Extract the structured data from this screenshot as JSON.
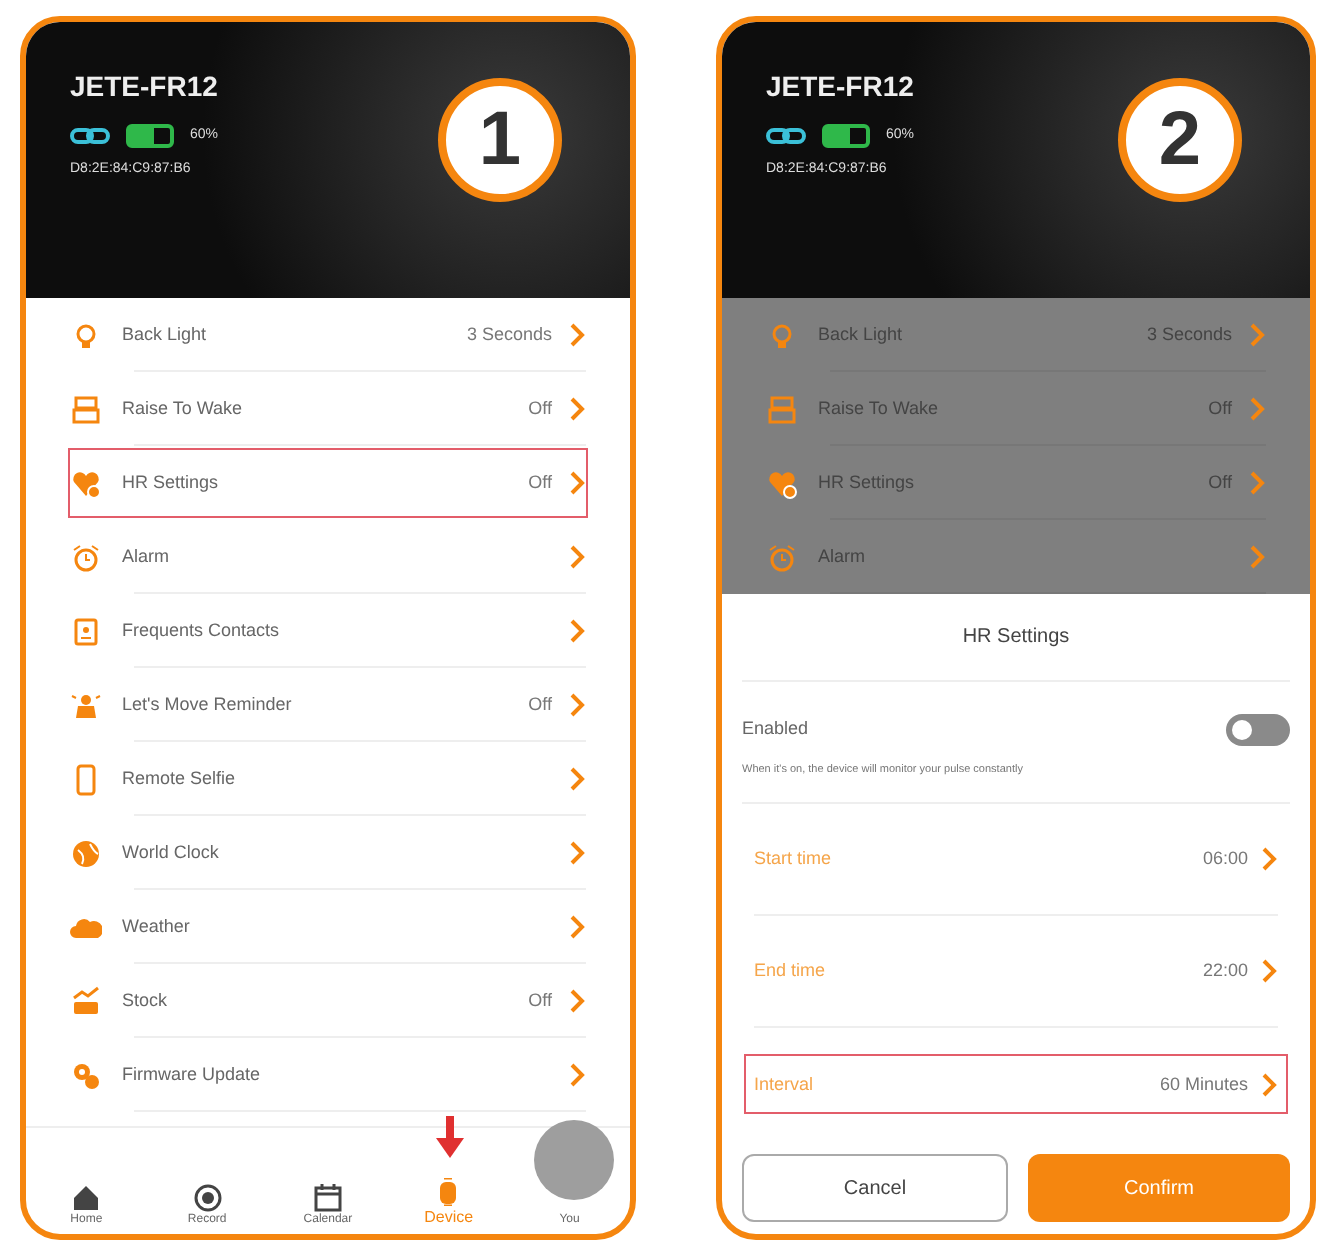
{
  "screens": [
    {
      "step": "1",
      "device": {
        "name": "JETE-FR12",
        "battery": {
          "level": 0.6,
          "text": "60%"
        },
        "address": "D8:2E:84:C9:87:B6"
      },
      "settings": [
        {
          "label": "Back Light",
          "value": "3 Seconds",
          "highlighted": false
        },
        {
          "label": "Raise To Wake",
          "value": "Off",
          "highlighted": false
        },
        {
          "label": "HR Settings",
          "value": "Off",
          "highlighted": true
        },
        {
          "label": "Alarm",
          "highlighted": false
        },
        {
          "label": "Frequents Contacts",
          "highlighted": false
        },
        {
          "label": "Let's Move Reminder",
          "value": "Off",
          "highlighted": false
        },
        {
          "label": "Remote Selfie",
          "highlighted": false
        },
        {
          "label": "World Clock",
          "highlighted": false
        },
        {
          "label": "Weather",
          "highlighted": false
        },
        {
          "label": "Stock",
          "value": "Off",
          "highlighted": false
        },
        {
          "label": "Firmware Update",
          "highlighted": false
        }
      ],
      "tab_bar": [
        {
          "label": "Home",
          "selected": false
        },
        {
          "label": "Record",
          "selected": false
        },
        {
          "label": "Calendar",
          "selected": false
        },
        {
          "label": "Device",
          "selected": true,
          "pointed": true
        },
        {
          "label": "You",
          "selected": false,
          "avatar": true
        }
      ]
    },
    {
      "step": "2",
      "device": {
        "name": "JETE-FR12",
        "battery": {
          "level": 0.6,
          "text": "60%"
        },
        "address": "D8:2E:84:C9:87:B6"
      },
      "settings": [
        {
          "label": "Back Light",
          "value": "3 Seconds",
          "highlighted": false
        },
        {
          "label": "Raise To Wake",
          "value": "Off",
          "highlighted": false
        },
        {
          "label": "HR Settings",
          "value": "Off",
          "highlighted": false
        },
        {
          "label": "Alarm",
          "highlighted": false
        }
      ],
      "sheet": {
        "title": "HR Settings",
        "toggle": {
          "label": "Enabled",
          "on": false
        },
        "note": "When it's on, the device will monitor your pulse constantly",
        "rows": [
          {
            "label": "Start time",
            "value": "06:00",
            "highlighted": false
          },
          {
            "label": "End time",
            "value": "22:00",
            "highlighted": false
          },
          {
            "label": "Interval",
            "value": "60 Minutes",
            "highlighted": true
          }
        ],
        "buttons": [
          {
            "label": "Cancel",
            "kind": "secondary"
          },
          {
            "label": "Confirm",
            "kind": "primary"
          }
        ]
      }
    }
  ]
}
